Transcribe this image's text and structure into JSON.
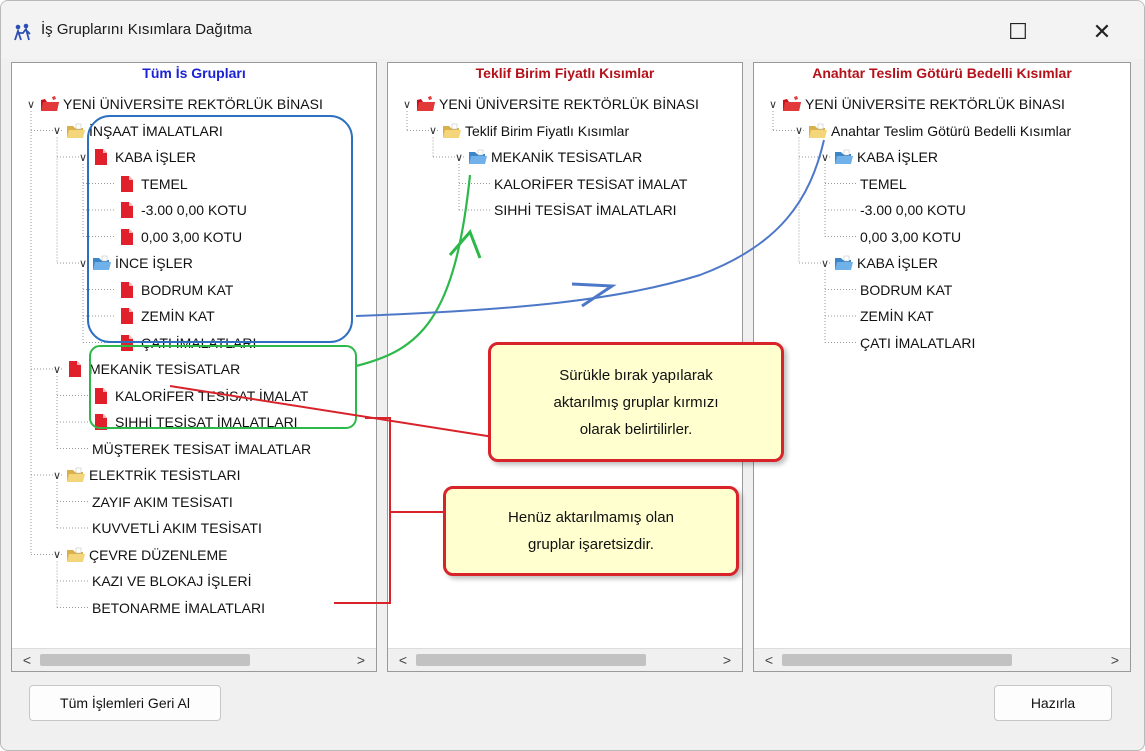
{
  "window": {
    "title": "İş Gruplarını Kısımlara Dağıtma",
    "maximize_glyph": "☐",
    "close_glyph": "✕"
  },
  "panels": [
    {
      "header": "Tüm İs Grupları",
      "header_color": "#1a22d6",
      "nodes": [
        {
          "label": "YENİ ÜNİVERSİTE REKTÖRLÜK BİNASI",
          "level": 0,
          "icon": "red-folder",
          "expanded": true
        },
        {
          "label": "İNŞAAT İMALATLARI",
          "level": 1,
          "icon": "yellow-folder",
          "expanded": true
        },
        {
          "label": "KABA İŞLER",
          "level": 2,
          "icon": "red-document",
          "expanded": true
        },
        {
          "label": "TEMEL",
          "level": 3,
          "icon": "red-document"
        },
        {
          "label": "-3.00  0,00 KOTU",
          "level": 3,
          "icon": "red-document"
        },
        {
          "label": "0,00  3,00 KOTU",
          "level": 3,
          "icon": "red-document"
        },
        {
          "label": "İNCE İŞLER",
          "level": 2,
          "icon": "blue-folder",
          "expanded": true
        },
        {
          "label": "BODRUM KAT",
          "level": 3,
          "icon": "red-document"
        },
        {
          "label": "ZEMİN KAT",
          "level": 3,
          "icon": "red-document"
        },
        {
          "label": "ÇATI İMALATLARI",
          "level": 3,
          "icon": "red-document"
        },
        {
          "label": "MEKANİK TESİSATLAR",
          "level": 1,
          "icon": "red-document",
          "expanded": true
        },
        {
          "label": "KALORİFER TESİSAT İMALAT",
          "level": 2,
          "icon": "red-document"
        },
        {
          "label": "SIHHİ TESİSAT İMALATLARI",
          "level": 2,
          "icon": "red-document"
        },
        {
          "label": "MÜŞTEREK TESİSAT İMALATLAR",
          "level": 2,
          "icon": "none"
        },
        {
          "label": "ELEKTRİK TESİSTLARI",
          "level": 1,
          "icon": "yellow-folder",
          "expanded": true
        },
        {
          "label": "ZAYIF AKIM TESİSATI",
          "level": 2,
          "icon": "none"
        },
        {
          "label": "KUVVETLİ AKIM TESİSATI",
          "level": 2,
          "icon": "none"
        },
        {
          "label": "ÇEVRE DÜZENLEME",
          "level": 1,
          "icon": "yellow-folder",
          "expanded": true
        },
        {
          "label": "KAZI VE BLOKAJ İŞLERİ",
          "level": 2,
          "icon": "none"
        },
        {
          "label": "BETONARME İMALATLARI",
          "level": 2,
          "icon": "none"
        }
      ]
    },
    {
      "header": "Teklif Birim Fiyatlı Kısımlar",
      "header_color": "#b3121b",
      "nodes": [
        {
          "label": "YENİ ÜNİVERSİTE REKTÖRLÜK BİNASI",
          "level": 0,
          "icon": "red-folder",
          "expanded": true
        },
        {
          "label": "Teklif Birim Fiyatlı Kısımlar",
          "level": 1,
          "icon": "yellow-folder",
          "expanded": true
        },
        {
          "label": "MEKANİK TESİSATLAR",
          "level": 2,
          "icon": "blue-folder",
          "expanded": true
        },
        {
          "label": "KALORİFER TESİSAT İMALAT",
          "level": 3,
          "icon": "none"
        },
        {
          "label": "SIHHİ TESİSAT İMALATLARI",
          "level": 3,
          "icon": "none"
        }
      ]
    },
    {
      "header": "Anahtar Teslim Götürü Bedelli Kısımlar",
      "header_color": "#b3121b",
      "nodes": [
        {
          "label": "YENİ ÜNİVERSİTE REKTÖRLÜK BİNASI",
          "level": 0,
          "icon": "red-folder",
          "expanded": true
        },
        {
          "label": "Anahtar Teslim Götürü Bedelli Kısımlar",
          "level": 1,
          "icon": "yellow-folder",
          "expanded": true
        },
        {
          "label": "KABA İŞLER",
          "level": 2,
          "icon": "blue-folder",
          "expanded": true
        },
        {
          "label": "TEMEL",
          "level": 3,
          "icon": "none"
        },
        {
          "label": "-3.00  0,00 KOTU",
          "level": 3,
          "icon": "none"
        },
        {
          "label": "0,00  3,00 KOTU",
          "level": 3,
          "icon": "none"
        },
        {
          "label": "KABA İŞLER",
          "level": 2,
          "icon": "blue-folder",
          "expanded": true
        },
        {
          "label": "BODRUM KAT",
          "level": 3,
          "icon": "none"
        },
        {
          "label": "ZEMİN KAT",
          "level": 3,
          "icon": "none"
        },
        {
          "label": "ÇATI İMALATLARI",
          "level": 3,
          "icon": "none"
        }
      ]
    }
  ],
  "scroll": {
    "left_arrow": "<",
    "right_arrow": ">"
  },
  "callouts": {
    "dragged": "Sürükle bırak yapılarak\naktarılmış gruplar kırmızı\nolarak belirtilirler.",
    "not_moved": "Henüz aktarılmamış olan\ngruplar işaretsizdir."
  },
  "buttons": {
    "undo_all": "Tüm İşlemleri Geri Al",
    "prepare": "Hazırla"
  },
  "colors": {
    "highlight_blue": "#2d6fc0",
    "highlight_green": "#2db84a",
    "annotation_red": "#d8232a",
    "arrow_blue": "#4d78c8"
  }
}
